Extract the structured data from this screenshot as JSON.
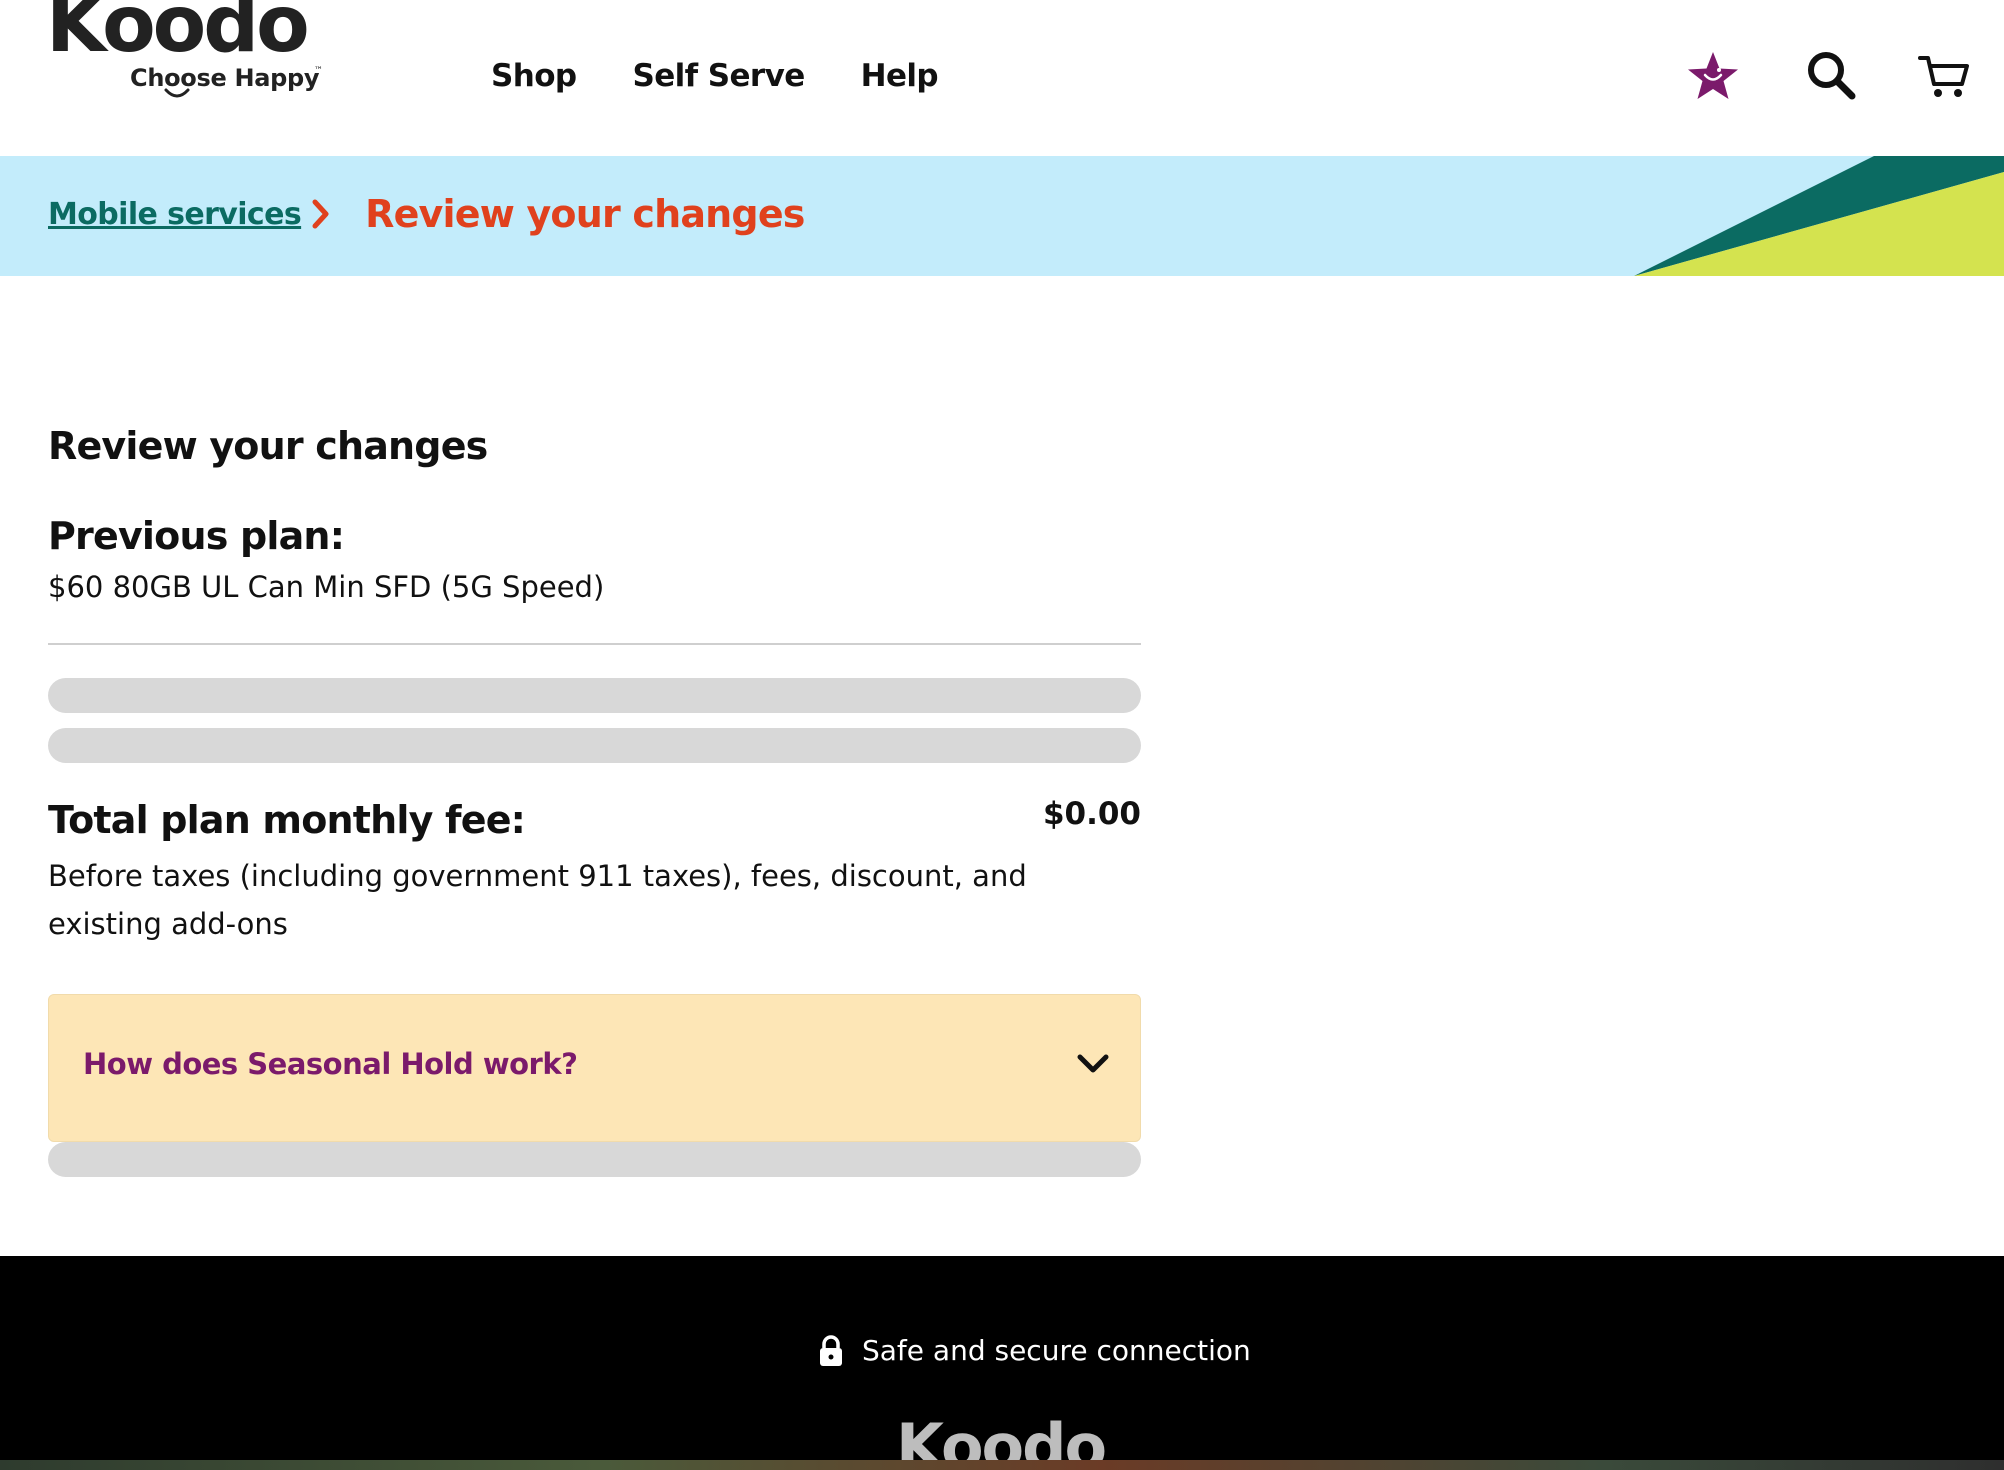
{
  "brand": {
    "name": "Koodo",
    "tagline": "Choose Happy",
    "accent_purple": "#7b1a6b",
    "accent_orange": "#e0411d",
    "accent_teal": "#0b6b62"
  },
  "header": {
    "nav": [
      "Shop",
      "Self Serve",
      "Help"
    ],
    "icons": [
      "perks-star-icon",
      "search-icon",
      "cart-icon"
    ]
  },
  "breadcrumb": {
    "parent": "Mobile services",
    "current": "Review your changes"
  },
  "main": {
    "title": "Review your changes",
    "previous_label": "Previous plan:",
    "previous_value": "$60 80GB UL Can Min SFD (5G Speed)",
    "total_label": "Total plan monthly fee:",
    "total_value": "$0.00",
    "total_desc": "Before taxes (including government 911 taxes), fees, discount, and existing add-ons",
    "faq_title": "How does Seasonal Hold work?"
  },
  "footer": {
    "secure_text": "Safe and secure connection",
    "logo": "Koodo"
  }
}
